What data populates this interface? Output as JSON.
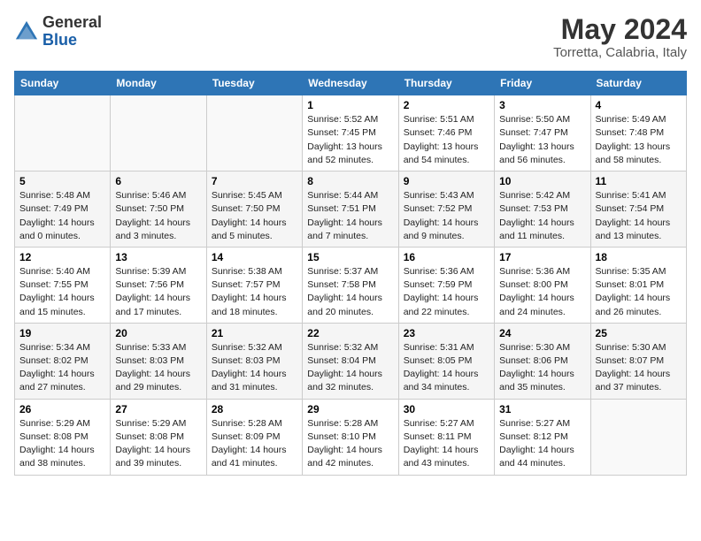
{
  "header": {
    "logo_line1": "General",
    "logo_line2": "Blue",
    "month_year": "May 2024",
    "location": "Torretta, Calabria, Italy"
  },
  "weekdays": [
    "Sunday",
    "Monday",
    "Tuesday",
    "Wednesday",
    "Thursday",
    "Friday",
    "Saturday"
  ],
  "rows": [
    [
      {
        "day": "",
        "info": ""
      },
      {
        "day": "",
        "info": ""
      },
      {
        "day": "",
        "info": ""
      },
      {
        "day": "1",
        "info": "Sunrise: 5:52 AM\nSunset: 7:45 PM\nDaylight: 13 hours\nand 52 minutes."
      },
      {
        "day": "2",
        "info": "Sunrise: 5:51 AM\nSunset: 7:46 PM\nDaylight: 13 hours\nand 54 minutes."
      },
      {
        "day": "3",
        "info": "Sunrise: 5:50 AM\nSunset: 7:47 PM\nDaylight: 13 hours\nand 56 minutes."
      },
      {
        "day": "4",
        "info": "Sunrise: 5:49 AM\nSunset: 7:48 PM\nDaylight: 13 hours\nand 58 minutes."
      }
    ],
    [
      {
        "day": "5",
        "info": "Sunrise: 5:48 AM\nSunset: 7:49 PM\nDaylight: 14 hours\nand 0 minutes."
      },
      {
        "day": "6",
        "info": "Sunrise: 5:46 AM\nSunset: 7:50 PM\nDaylight: 14 hours\nand 3 minutes."
      },
      {
        "day": "7",
        "info": "Sunrise: 5:45 AM\nSunset: 7:50 PM\nDaylight: 14 hours\nand 5 minutes."
      },
      {
        "day": "8",
        "info": "Sunrise: 5:44 AM\nSunset: 7:51 PM\nDaylight: 14 hours\nand 7 minutes."
      },
      {
        "day": "9",
        "info": "Sunrise: 5:43 AM\nSunset: 7:52 PM\nDaylight: 14 hours\nand 9 minutes."
      },
      {
        "day": "10",
        "info": "Sunrise: 5:42 AM\nSunset: 7:53 PM\nDaylight: 14 hours\nand 11 minutes."
      },
      {
        "day": "11",
        "info": "Sunrise: 5:41 AM\nSunset: 7:54 PM\nDaylight: 14 hours\nand 13 minutes."
      }
    ],
    [
      {
        "day": "12",
        "info": "Sunrise: 5:40 AM\nSunset: 7:55 PM\nDaylight: 14 hours\nand 15 minutes."
      },
      {
        "day": "13",
        "info": "Sunrise: 5:39 AM\nSunset: 7:56 PM\nDaylight: 14 hours\nand 17 minutes."
      },
      {
        "day": "14",
        "info": "Sunrise: 5:38 AM\nSunset: 7:57 PM\nDaylight: 14 hours\nand 18 minutes."
      },
      {
        "day": "15",
        "info": "Sunrise: 5:37 AM\nSunset: 7:58 PM\nDaylight: 14 hours\nand 20 minutes."
      },
      {
        "day": "16",
        "info": "Sunrise: 5:36 AM\nSunset: 7:59 PM\nDaylight: 14 hours\nand 22 minutes."
      },
      {
        "day": "17",
        "info": "Sunrise: 5:36 AM\nSunset: 8:00 PM\nDaylight: 14 hours\nand 24 minutes."
      },
      {
        "day": "18",
        "info": "Sunrise: 5:35 AM\nSunset: 8:01 PM\nDaylight: 14 hours\nand 26 minutes."
      }
    ],
    [
      {
        "day": "19",
        "info": "Sunrise: 5:34 AM\nSunset: 8:02 PM\nDaylight: 14 hours\nand 27 minutes."
      },
      {
        "day": "20",
        "info": "Sunrise: 5:33 AM\nSunset: 8:03 PM\nDaylight: 14 hours\nand 29 minutes."
      },
      {
        "day": "21",
        "info": "Sunrise: 5:32 AM\nSunset: 8:03 PM\nDaylight: 14 hours\nand 31 minutes."
      },
      {
        "day": "22",
        "info": "Sunrise: 5:32 AM\nSunset: 8:04 PM\nDaylight: 14 hours\nand 32 minutes."
      },
      {
        "day": "23",
        "info": "Sunrise: 5:31 AM\nSunset: 8:05 PM\nDaylight: 14 hours\nand 34 minutes."
      },
      {
        "day": "24",
        "info": "Sunrise: 5:30 AM\nSunset: 8:06 PM\nDaylight: 14 hours\nand 35 minutes."
      },
      {
        "day": "25",
        "info": "Sunrise: 5:30 AM\nSunset: 8:07 PM\nDaylight: 14 hours\nand 37 minutes."
      }
    ],
    [
      {
        "day": "26",
        "info": "Sunrise: 5:29 AM\nSunset: 8:08 PM\nDaylight: 14 hours\nand 38 minutes."
      },
      {
        "day": "27",
        "info": "Sunrise: 5:29 AM\nSunset: 8:08 PM\nDaylight: 14 hours\nand 39 minutes."
      },
      {
        "day": "28",
        "info": "Sunrise: 5:28 AM\nSunset: 8:09 PM\nDaylight: 14 hours\nand 41 minutes."
      },
      {
        "day": "29",
        "info": "Sunrise: 5:28 AM\nSunset: 8:10 PM\nDaylight: 14 hours\nand 42 minutes."
      },
      {
        "day": "30",
        "info": "Sunrise: 5:27 AM\nSunset: 8:11 PM\nDaylight: 14 hours\nand 43 minutes."
      },
      {
        "day": "31",
        "info": "Sunrise: 5:27 AM\nSunset: 8:12 PM\nDaylight: 14 hours\nand 44 minutes."
      },
      {
        "day": "",
        "info": ""
      }
    ]
  ]
}
